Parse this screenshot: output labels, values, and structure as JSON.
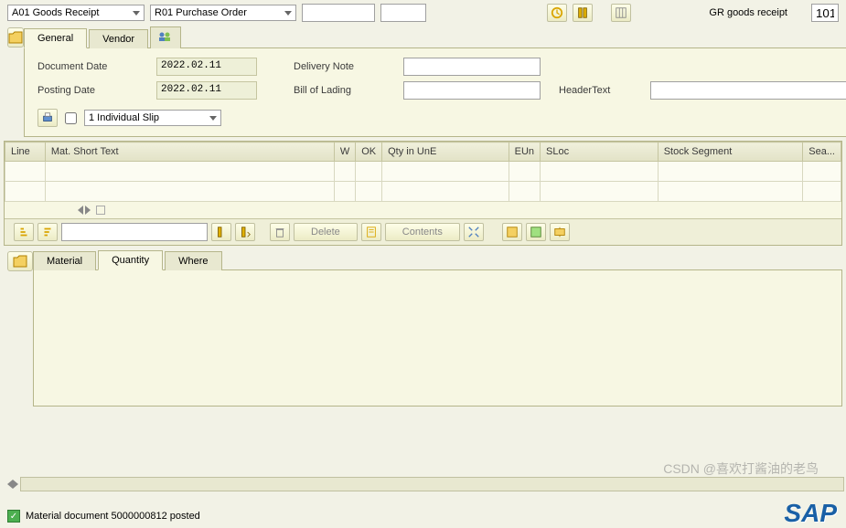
{
  "topbar": {
    "action_dd": "A01 Goods Receipt",
    "ref_dd": "R01 Purchase Order",
    "input1": "",
    "input2": "",
    "status_label": "GR goods receipt",
    "code": "101"
  },
  "tabs1": {
    "general": "General",
    "vendor": "Vendor"
  },
  "form": {
    "doc_date_lbl": "Document Date",
    "doc_date": "2022.02.11",
    "post_date_lbl": "Posting Date",
    "post_date": "2022.02.11",
    "deliv_note_lbl": "Delivery Note",
    "deliv_note": "",
    "bol_lbl": "Bill of Lading",
    "bol": "",
    "header_text_lbl": "HeaderText",
    "header_text": "",
    "slip_dd": "1 Individual Slip"
  },
  "grid_headers": {
    "line": "Line",
    "mat": "Mat. Short Text",
    "w": "W",
    "ok": "OK",
    "qty": "Qty in UnE",
    "eun": "EUn",
    "sloc": "SLoc",
    "stockseg": "Stock Segment",
    "sea": "Sea..."
  },
  "toolbar2": {
    "delete": "Delete",
    "contents": "Contents"
  },
  "tabs2": {
    "material": "Material",
    "quantity": "Quantity",
    "where": "Where"
  },
  "status_msg": "Material document 5000000812 posted",
  "watermark": "CSDN @喜欢打酱油的老鸟",
  "logo": "SAP"
}
